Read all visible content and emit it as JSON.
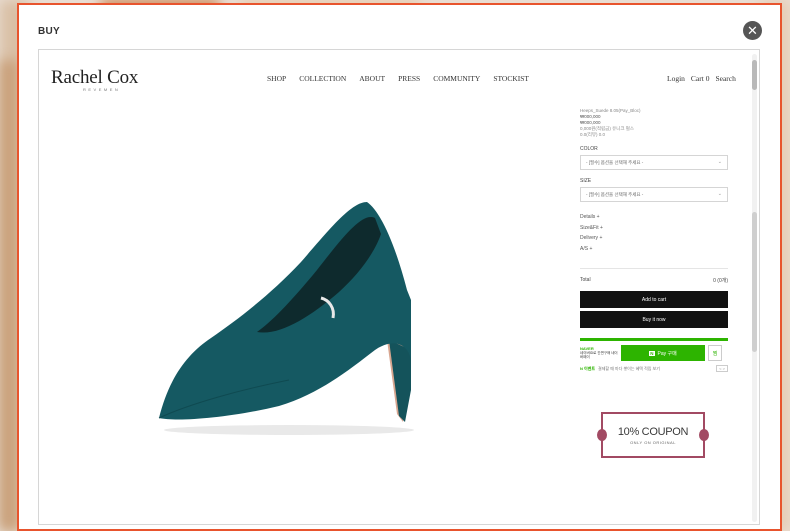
{
  "modal": {
    "title": "BUY",
    "close_label": "✕"
  },
  "site": {
    "logo": "Rachel Cox",
    "logo_sub": "REVEMEN",
    "nav": [
      "SHOP",
      "COLLECTION",
      "ABOUT",
      "PRESS",
      "COMMUNITY",
      "STOCKIST"
    ],
    "util": [
      "Login",
      "Cart 0",
      "Search"
    ]
  },
  "product": {
    "info_lines": [
      "Heeps_Suede 8.05(Pay_Bloc)",
      "₩000,000",
      "₩000,000",
      "0,000원(적립금) 유니크 펄스",
      "0.0(리뷰) 0.0"
    ],
    "color_label": "COLOR",
    "color_placeholder": "- [필수] 옵션을 선택해 주세요 -",
    "size_label": "SIZE",
    "size_placeholder": "- [필수] 옵션을 선택해 주세요 -",
    "links": [
      "Details +",
      "Size&Fit +",
      "Delivery +",
      "A/S +"
    ],
    "total_label": "Total",
    "total_value": "0 (0개)",
    "add_to_cart": "Add to cart",
    "buy_now": "Buy it now"
  },
  "npay": {
    "brand": "NAVER",
    "left_text": "네이버ID로 간편구매 네이버페이",
    "button_label": "Pay 구매",
    "wish_icon": "찜",
    "note_brand": "N 이벤트",
    "note_text": "결제할 때 마다 쌓이는 혜택 적립 보기",
    "arrows": "< >"
  },
  "coupon": {
    "main": "10% COUPON",
    "sub": "ONLY ON ORIGINAL"
  },
  "colors": {
    "accent_border": "#e8542d",
    "npay_green": "#2db400",
    "coupon_border": "#a24a63",
    "shoe_color": "#155962"
  }
}
